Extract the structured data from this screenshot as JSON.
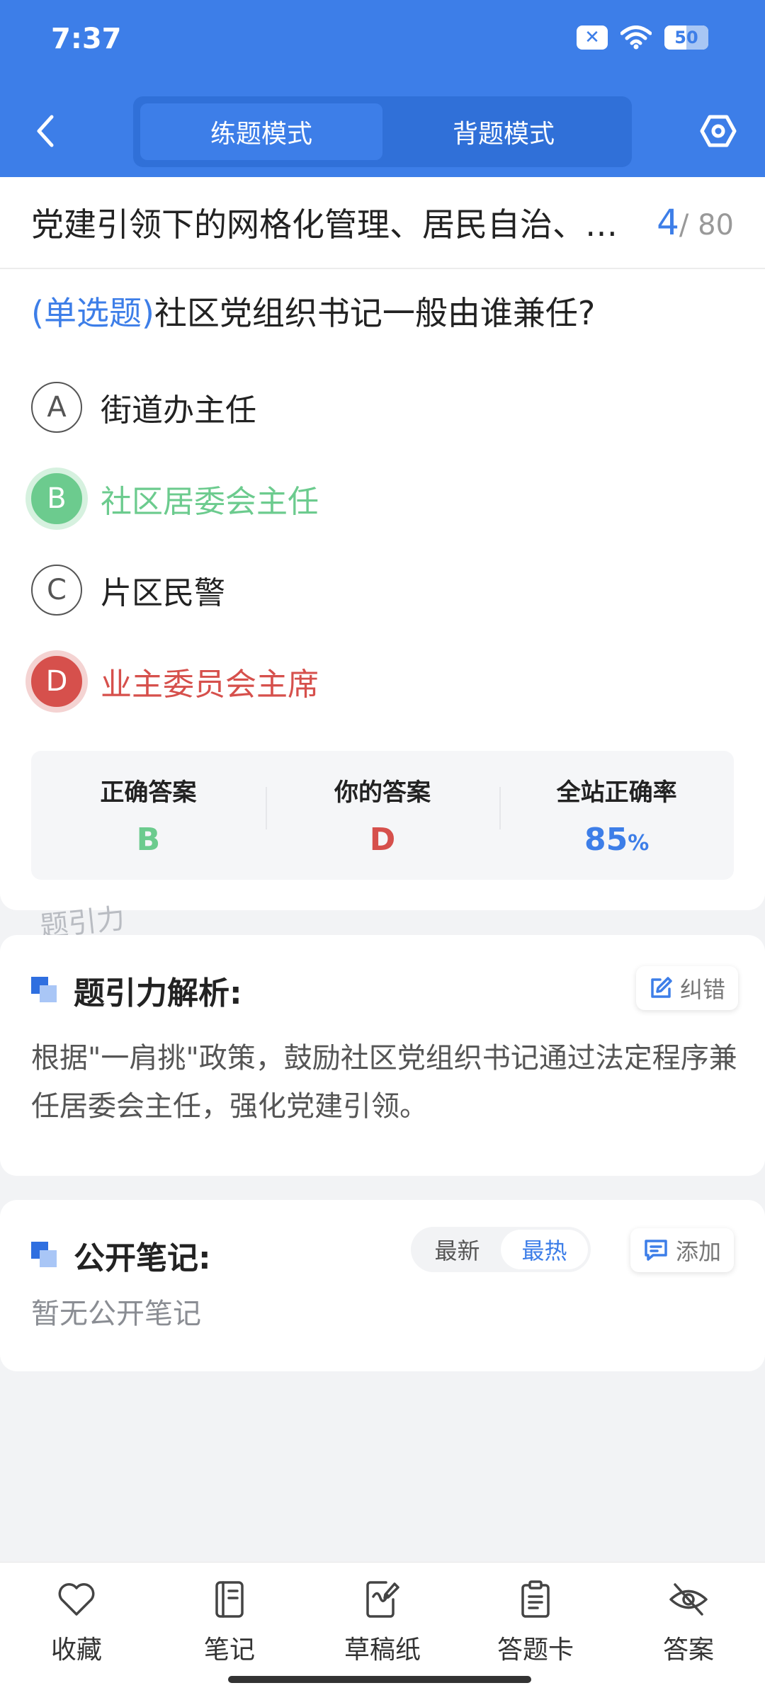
{
  "status_bar": {
    "time": "7:37",
    "battery": "50"
  },
  "header": {
    "tabs": [
      {
        "label": "练题模式",
        "active": true
      },
      {
        "label": "背题模式",
        "active": false
      }
    ]
  },
  "question": {
    "chapter_title": "党建引领下的网格化管理、居民自治、…",
    "current": "4",
    "total": "/ 80",
    "type_label": "(单选题)",
    "stem": "社区党组织书记一般由谁兼任?",
    "options": [
      {
        "letter": "A",
        "text": "街道办主任",
        "state": "normal"
      },
      {
        "letter": "B",
        "text": "社区居委会主任",
        "state": "correct"
      },
      {
        "letter": "C",
        "text": "片区民警",
        "state": "normal"
      },
      {
        "letter": "D",
        "text": "业主委员会主席",
        "state": "wrong"
      }
    ]
  },
  "answer_summary": {
    "correct_label": "正确答案",
    "correct_value": "B",
    "yours_label": "你的答案",
    "yours_value": "D",
    "rate_label": "全站正确率",
    "rate_value": "85",
    "rate_unit": "%"
  },
  "watermark": "题引力",
  "analysis": {
    "title": "题引力解析:",
    "report_label": "纠错",
    "text": "根据\"一肩挑\"政策，鼓励社区党组织书记通过法定程序兼任居委会主任，强化党建引领。"
  },
  "notes": {
    "title": "公开笔记:",
    "sort_options": [
      {
        "label": "最新",
        "active": false
      },
      {
        "label": "最热",
        "active": true
      }
    ],
    "add_label": "添加",
    "empty_text": "暂无公开笔记"
  },
  "bottom_nav": [
    {
      "label": "收藏",
      "icon": "heart-icon"
    },
    {
      "label": "笔记",
      "icon": "notebook-icon"
    },
    {
      "label": "草稿纸",
      "icon": "draft-paper-icon"
    },
    {
      "label": "答题卡",
      "icon": "answer-sheet-icon"
    },
    {
      "label": "答案",
      "icon": "eye-off-icon"
    }
  ],
  "colors": {
    "primary": "#3d7ee8",
    "correct": "#6ccb8e",
    "wrong": "#d6504c"
  }
}
